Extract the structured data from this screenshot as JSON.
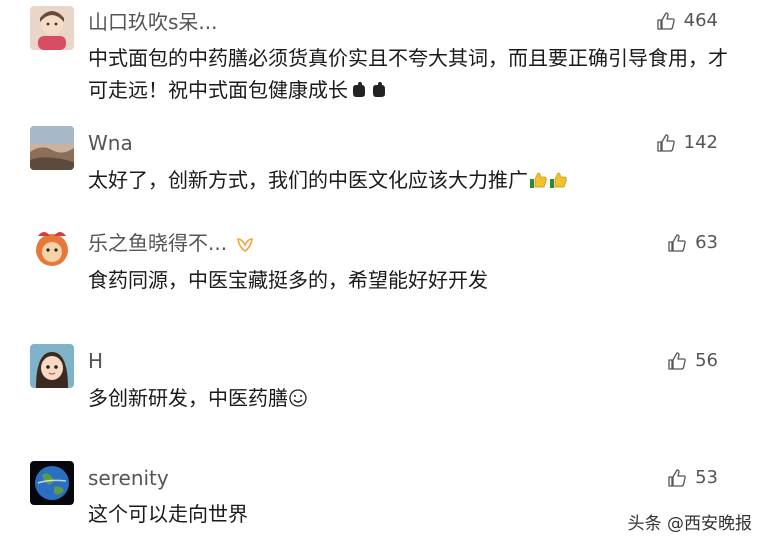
{
  "comments": [
    {
      "username": "山口玖吹s呆...",
      "likes": "464",
      "text": "中式面包的中药膳必须货真价实且不夸大其词，而且要正确引导食用，才可走远！祝中式面包健康成长",
      "avatar_icon": "girl-portrait-avatar",
      "emoji_icon": "fist-emoji"
    },
    {
      "username": "Wna",
      "likes": "142",
      "text": "太好了，创新方式，我们的中医文化应该大力推广",
      "avatar_icon": "landscape-avatar",
      "emoji_icon": "thumbs-up-emoji"
    },
    {
      "username": "乐之鱼晓得不...",
      "likes": "63",
      "text": "食药同源，中医宝藏挺多的，希望能好好开发",
      "avatar_icon": "cartoon-avatar",
      "badge_icon": "member-badge"
    },
    {
      "username": "H",
      "likes": "56",
      "text": "多创新研发，中医药膳",
      "avatar_icon": "cartoon-girl-avatar",
      "emoji_icon": "smile-emoji"
    },
    {
      "username": "serenity",
      "likes": "53",
      "text": "这个可以走向世界",
      "avatar_icon": "earth-avatar"
    }
  ],
  "watermark": "头条 @西安晚报"
}
